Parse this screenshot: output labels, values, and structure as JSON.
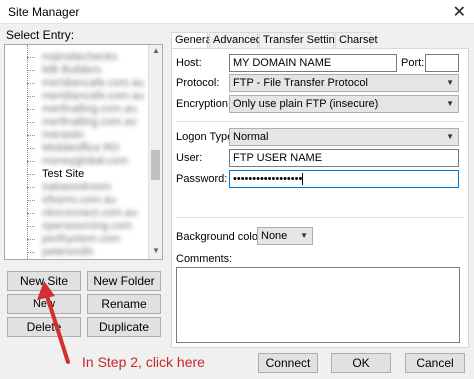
{
  "window": {
    "title": "Site Manager",
    "close_glyph": "✕"
  },
  "left": {
    "select_entry_label": "Select Entry:",
    "tree_items": [
      {
        "label": "mainsitechecks",
        "blurred": true
      },
      {
        "label": "MB Builders",
        "blurred": true
      },
      {
        "label": "meridiancafe.com.au",
        "blurred": true
      },
      {
        "label": "meridiancafe.com.au",
        "blurred": true
      },
      {
        "label": "merlinalling.com.au",
        "blurred": true
      },
      {
        "label": "merlinalling.com.au",
        "blurred": true
      },
      {
        "label": "merastin",
        "blurred": true
      },
      {
        "label": "Mobileoffice RD",
        "blurred": true
      },
      {
        "label": "moneyglobal.com",
        "blurred": true
      },
      {
        "label": "Test Site",
        "blurred": false
      },
      {
        "label": "oakwoodroom",
        "blurred": true
      },
      {
        "label": "ofssms.com.au",
        "blurred": true
      },
      {
        "label": "nkoconnect.com.au",
        "blurred": true
      },
      {
        "label": "opensourcing.com",
        "blurred": true
      },
      {
        "label": "perthystem.com",
        "blurred": true
      },
      {
        "label": "petersmith",
        "blurred": true
      }
    ],
    "buttons": {
      "new_site": "New Site",
      "new_folder": "New Folder",
      "new_bookmark": "New Bookmark",
      "rename": "Rename",
      "delete": "Delete",
      "duplicate": "Duplicate"
    }
  },
  "tabs": [
    "General",
    "Advanced",
    "Transfer Settings",
    "Charset"
  ],
  "general": {
    "host_label": "Host:",
    "host_value": "MY DOMAIN NAME",
    "port_label": "Port:",
    "port_value": "",
    "protocol_label": "Protocol:",
    "protocol_value": "FTP - File Transfer Protocol",
    "encryption_label": "Encryption:",
    "encryption_value": "Only use plain FTP (insecure)",
    "logon_type_label": "Logon Type:",
    "logon_type_value": "Normal",
    "user_label": "User:",
    "user_value": "FTP USER NAME",
    "password_label": "Password:",
    "password_value": "••••••••••••••••••",
    "bg_color_label": "Background color:",
    "bg_color_value": "None",
    "comments_label": "Comments:",
    "comments_value": ""
  },
  "footer": {
    "connect": "Connect",
    "ok": "OK",
    "cancel": "Cancel"
  },
  "annotation": {
    "text": "In Step 2, click here",
    "color": "#c62828"
  }
}
